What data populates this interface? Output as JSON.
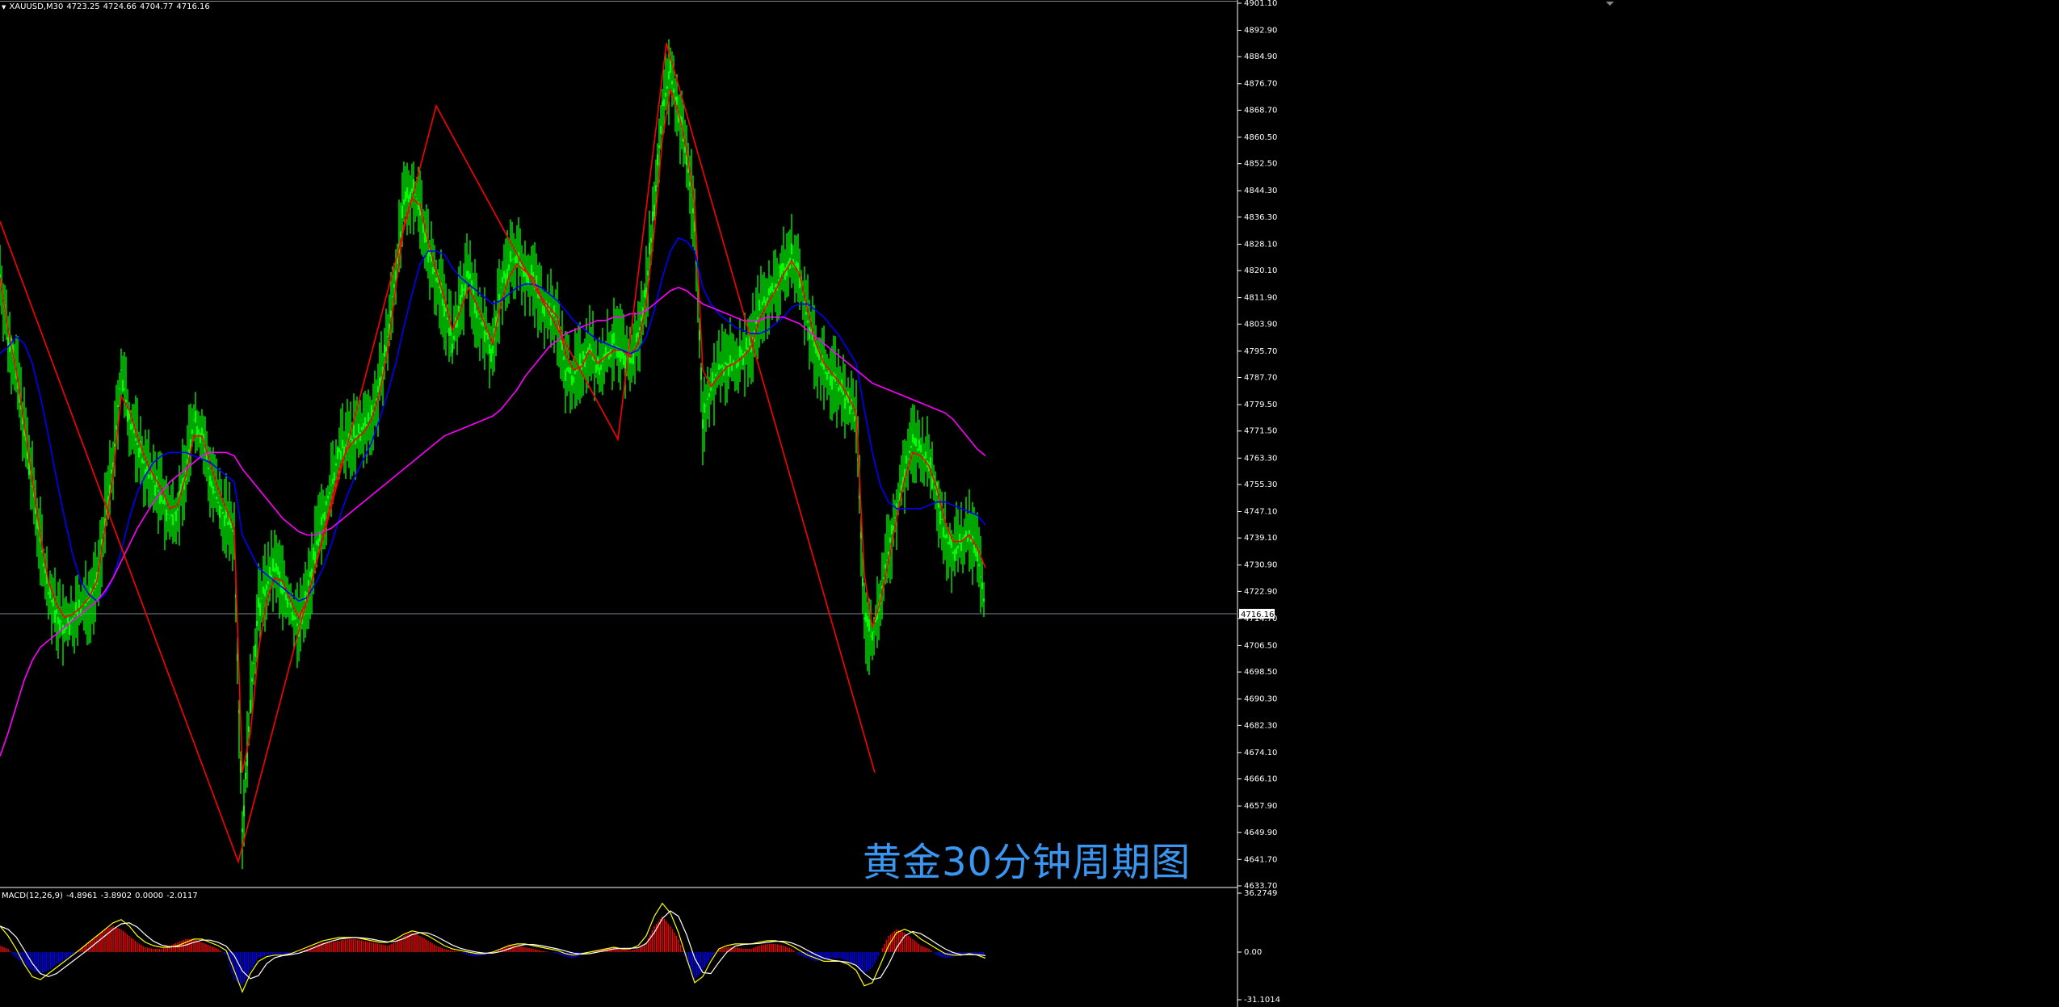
{
  "header": {
    "symbol": "XAUUSD,M30",
    "ohlc": [
      "4723.25",
      "4724.66",
      "4704.77",
      "4716.16"
    ]
  },
  "macd_header": {
    "label": "MACD(12,26,9)",
    "values": [
      "-4.8961",
      "-3.8902",
      "0.0000",
      "-2.0117"
    ]
  },
  "caption": "黄金30分钟周期图",
  "colors": {
    "background": "#000000",
    "candle": "#00ff00",
    "ma_fast": "#ff0000",
    "ma_mid": "#0000ff",
    "ma_slow": "#ff00ff",
    "zigzag": "#ff0000",
    "macd_pos": "#ff0000",
    "macd_neg": "#0000ff",
    "macd_line": "#ffff00",
    "signal_line": "#ffffff",
    "caption": "#3a96f0",
    "axis_text": "#ffffff",
    "current_price_line": "#778899"
  },
  "chart_data": [
    {
      "type": "line",
      "subtype": "candlestick",
      "title": "XAUUSD,M30",
      "y_ticks": [
        "4901.10",
        "4892.90",
        "4884.90",
        "4876.70",
        "4868.70",
        "4860.50",
        "4852.50",
        "4844.30",
        "4836.30",
        "4828.10",
        "4820.10",
        "4811.90",
        "4803.90",
        "4795.70",
        "4787.70",
        "4779.50",
        "4771.50",
        "4763.30",
        "4755.30",
        "4747.10",
        "4739.10",
        "4730.90",
        "4722.90",
        "4714.70",
        "4706.50",
        "4698.50",
        "4690.30",
        "4682.30",
        "4674.10",
        "4666.10",
        "4657.90",
        "4649.90",
        "4641.70",
        "4633.70"
      ],
      "ylim": [
        4633.7,
        4901.1
      ],
      "current_price": "4716.16",
      "series": [
        {
          "name": "Close",
          "x": [
            0,
            10,
            20,
            30,
            40,
            50,
            60,
            70,
            80,
            90,
            100,
            110,
            120,
            130,
            140,
            150,
            160,
            170,
            180,
            190,
            200,
            210,
            220,
            230,
            240,
            250,
            260,
            270,
            280,
            290,
            300,
            310,
            320,
            330,
            340,
            350,
            360,
            370,
            380,
            390,
            400,
            410,
            420,
            430,
            440,
            450,
            460,
            470,
            480,
            490,
            500,
            510,
            520,
            530,
            540,
            550,
            560,
            570,
            580,
            590,
            600,
            610,
            620,
            630,
            640,
            650,
            660,
            670,
            680,
            690,
            700,
            710,
            720,
            730,
            740,
            750,
            760,
            770,
            780,
            790,
            800,
            810,
            820,
            830,
            840,
            850,
            860,
            870,
            880,
            890,
            900,
            910,
            920,
            930,
            940,
            950,
            960,
            970,
            980,
            990,
            1000,
            1010,
            1020,
            1030,
            1040,
            1050,
            1060,
            1070,
            1080,
            1090,
            1100,
            1110,
            1120,
            1130,
            1140,
            1150,
            1160,
            1170,
            1180,
            1190,
            1200,
            1210,
            1220
          ],
          "values": [
            4819,
            4800,
            4790,
            4772,
            4755,
            4738,
            4722,
            4716,
            4712,
            4715,
            4718,
            4720,
            4725,
            4745,
            4762,
            4790,
            4775,
            4768,
            4760,
            4756,
            4752,
            4745,
            4748,
            4760,
            4775,
            4770,
            4758,
            4750,
            4745,
            4740,
            4650,
            4690,
            4718,
            4725,
            4730,
            4725,
            4718,
            4712,
            4722,
            4735,
            4745,
            4755,
            4765,
            4768,
            4770,
            4772,
            4776,
            4785,
            4800,
            4820,
            4840,
            4845,
            4840,
            4826,
            4818,
            4810,
            4798,
            4810,
            4820,
            4808,
            4802,
            4795,
            4815,
            4822,
            4825,
            4820,
            4818,
            4810,
            4808,
            4805,
            4790,
            4788,
            4792,
            4798,
            4790,
            4794,
            4798,
            4796,
            4792,
            4800,
            4815,
            4840,
            4870,
            4880,
            4868,
            4855,
            4835,
            4775,
            4785,
            4790,
            4792,
            4792,
            4795,
            4798,
            4808,
            4812,
            4815,
            4820,
            4825,
            4818,
            4805,
            4795,
            4790,
            4788,
            4784,
            4780,
            4775,
            4715,
            4708,
            4722,
            4735,
            4748,
            4760,
            4768,
            4765,
            4762,
            4752,
            4740,
            4735,
            4738,
            4740,
            4735,
            4716
          ]
        },
        {
          "name": "MA fast (red)",
          "values": [
            4818,
            4802,
            4790,
            4774,
            4757,
            4740,
            4726,
            4719,
            4715,
            4716,
            4718,
            4721,
            4726,
            4742,
            4758,
            4782,
            4778,
            4770,
            4763,
            4758,
            4754,
            4748,
            4749,
            4758,
            4770,
            4770,
            4762,
            4754,
            4748,
            4742,
            4668,
            4680,
            4705,
            4720,
            4727,
            4726,
            4720,
            4715,
            4720,
            4730,
            4740,
            4750,
            4760,
            4766,
            4769,
            4771,
            4775,
            4783,
            4796,
            4815,
            4834,
            4842,
            4840,
            4829,
            4820,
            4812,
            4802,
            4808,
            4815,
            4810,
            4804,
            4798,
            4810,
            4818,
            4822,
            4820,
            4818,
            4812,
            4809,
            4806,
            4795,
            4790,
            4791,
            4796,
            4792,
            4794,
            4796,
            4796,
            4794,
            4798,
            4810,
            4832,
            4860,
            4875,
            4868,
            4857,
            4840,
            4790,
            4785,
            4788,
            4791,
            4792,
            4794,
            4797,
            4805,
            4810,
            4814,
            4819,
            4823,
            4819,
            4808,
            4798,
            4792,
            4789,
            4786,
            4782,
            4777,
            4728,
            4712,
            4720,
            4732,
            4745,
            4757,
            4765,
            4764,
            4761,
            4754,
            4744,
            4738,
            4738,
            4740,
            4736,
            4730
          ]
        },
        {
          "name": "MA mid (blue)",
          "values": [
            4795,
            4797,
            4800,
            4798,
            4792,
            4782,
            4770,
            4757,
            4745,
            4734,
            4726,
            4722,
            4720,
            4722,
            4727,
            4735,
            4745,
            4753,
            4758,
            4762,
            4764,
            4765,
            4765,
            4765,
            4764,
            4763,
            4762,
            4760,
            4758,
            4756,
            4740,
            4735,
            4730,
            4728,
            4726,
            4724,
            4722,
            4720,
            4721,
            4725,
            4730,
            4737,
            4745,
            4752,
            4758,
            4763,
            4768,
            4775,
            4783,
            4792,
            4803,
            4813,
            4822,
            4826,
            4826,
            4825,
            4821,
            4818,
            4816,
            4814,
            4812,
            4810,
            4811,
            4813,
            4815,
            4816,
            4816,
            4815,
            4813,
            4811,
            4808,
            4805,
            4803,
            4801,
            4799,
            4798,
            4797,
            4796,
            4795,
            4796,
            4800,
            4808,
            4818,
            4826,
            4830,
            4829,
            4826,
            4815,
            4810,
            4807,
            4805,
            4803,
            4802,
            4801,
            4801,
            4802,
            4804,
            4806,
            4809,
            4810,
            4810,
            4808,
            4806,
            4803,
            4800,
            4796,
            4792,
            4778,
            4765,
            4755,
            4750,
            4748,
            4748,
            4748,
            4748,
            4749,
            4750,
            4750,
            4749,
            4748,
            4747,
            4746,
            4743
          ]
        },
        {
          "name": "MA slow (magenta)",
          "values": [
            4673,
            4680,
            4688,
            4696,
            4702,
            4706,
            4708,
            4710,
            4712,
            4714,
            4716,
            4718,
            4720,
            4723,
            4727,
            4732,
            4737,
            4742,
            4746,
            4750,
            4753,
            4756,
            4758,
            4760,
            4762,
            4764,
            4765,
            4765,
            4765,
            4764,
            4760,
            4757,
            4754,
            4751,
            4748,
            4745,
            4743,
            4741,
            4740,
            4740,
            4741,
            4742,
            4744,
            4746,
            4748,
            4750,
            4752,
            4754,
            4756,
            4758,
            4760,
            4762,
            4764,
            4766,
            4768,
            4770,
            4771,
            4772,
            4773,
            4774,
            4775,
            4776,
            4778,
            4781,
            4784,
            4788,
            4791,
            4794,
            4797,
            4799,
            4801,
            4802,
            4803,
            4804,
            4805,
            4805,
            4806,
            4806,
            4807,
            4807,
            4808,
            4810,
            4812,
            4814,
            4815,
            4814,
            4812,
            4810,
            4809,
            4808,
            4807,
            4806,
            4805,
            4805,
            4805,
            4806,
            4806,
            4806,
            4805,
            4804,
            4802,
            4800,
            4798,
            4796,
            4794,
            4792,
            4790,
            4788,
            4786,
            4785,
            4784,
            4783,
            4782,
            4781,
            4780,
            4779,
            4778,
            4777,
            4775,
            4772,
            4769,
            4766,
            4764
          ]
        },
        {
          "name": "ZigZag",
          "points": [
            [
              0,
              4835
            ],
            [
              295,
              4641
            ],
            [
              540,
              4870
            ],
            [
              765,
              4769
            ],
            [
              825,
              4889
            ],
            [
              1083,
              4668
            ]
          ]
        }
      ]
    },
    {
      "type": "bar",
      "title": "MACD(12,26,9)",
      "y_ticks": [
        "36.2749",
        "0.00",
        "-31.1014"
      ],
      "ylim": [
        -31.1014,
        36.2749
      ],
      "series": [
        {
          "name": "MACD histogram",
          "values": [
            4,
            2,
            -4,
            -8,
            -12,
            -14,
            -12,
            -8,
            -5,
            -2,
            2,
            6,
            10,
            14,
            16,
            14,
            10,
            6,
            3,
            2,
            2,
            4,
            6,
            8,
            8,
            6,
            4,
            2,
            -2,
            -18,
            -22,
            -12,
            -4,
            -2,
            -2,
            -3,
            -2,
            0,
            2,
            4,
            6,
            6,
            7,
            8,
            8,
            7,
            6,
            5,
            4,
            6,
            10,
            12,
            10,
            7,
            4,
            2,
            1,
            0,
            -2,
            -3,
            -2,
            -1,
            2,
            4,
            4,
            3,
            2,
            1,
            0,
            -1,
            -3,
            -4,
            -2,
            0,
            1,
            2,
            3,
            2,
            1,
            2,
            6,
            16,
            22,
            16,
            8,
            -6,
            -18,
            -12,
            -4,
            2,
            3,
            3,
            2,
            2,
            4,
            5,
            5,
            4,
            2,
            -2,
            -4,
            -6,
            -5,
            -4,
            -4,
            -6,
            -8,
            -14,
            -10,
            0,
            10,
            14,
            12,
            8,
            4,
            2,
            -2,
            -4,
            -3,
            -2,
            -1,
            -2,
            -2
          ]
        },
        {
          "name": "MACD line",
          "values": [
            16,
            10,
            2,
            -8,
            -16,
            -18,
            -14,
            -10,
            -6,
            -2,
            2,
            6,
            10,
            14,
            18,
            20,
            16,
            10,
            6,
            4,
            3,
            3,
            4,
            6,
            8,
            8,
            6,
            4,
            1,
            -12,
            -26,
            -14,
            -6,
            -3,
            -2,
            -2,
            -1,
            1,
            3,
            5,
            7,
            8,
            9,
            9,
            9,
            8,
            7,
            6,
            6,
            8,
            11,
            13,
            12,
            10,
            7,
            4,
            2,
            1,
            0,
            -1,
            -1,
            0,
            2,
            4,
            5,
            5,
            4,
            3,
            2,
            1,
            -1,
            -2,
            -1,
            0,
            1,
            2,
            3,
            2,
            2,
            4,
            10,
            22,
            30,
            24,
            12,
            -4,
            -20,
            -16,
            -6,
            2,
            4,
            5,
            5,
            5,
            6,
            7,
            7,
            6,
            4,
            1,
            -2,
            -4,
            -6,
            -6,
            -6,
            -8,
            -12,
            -22,
            -20,
            -8,
            4,
            12,
            14,
            12,
            8,
            5,
            2,
            -1,
            -2,
            -2,
            -1,
            -2,
            -4
          ]
        }
      ]
    }
  ]
}
